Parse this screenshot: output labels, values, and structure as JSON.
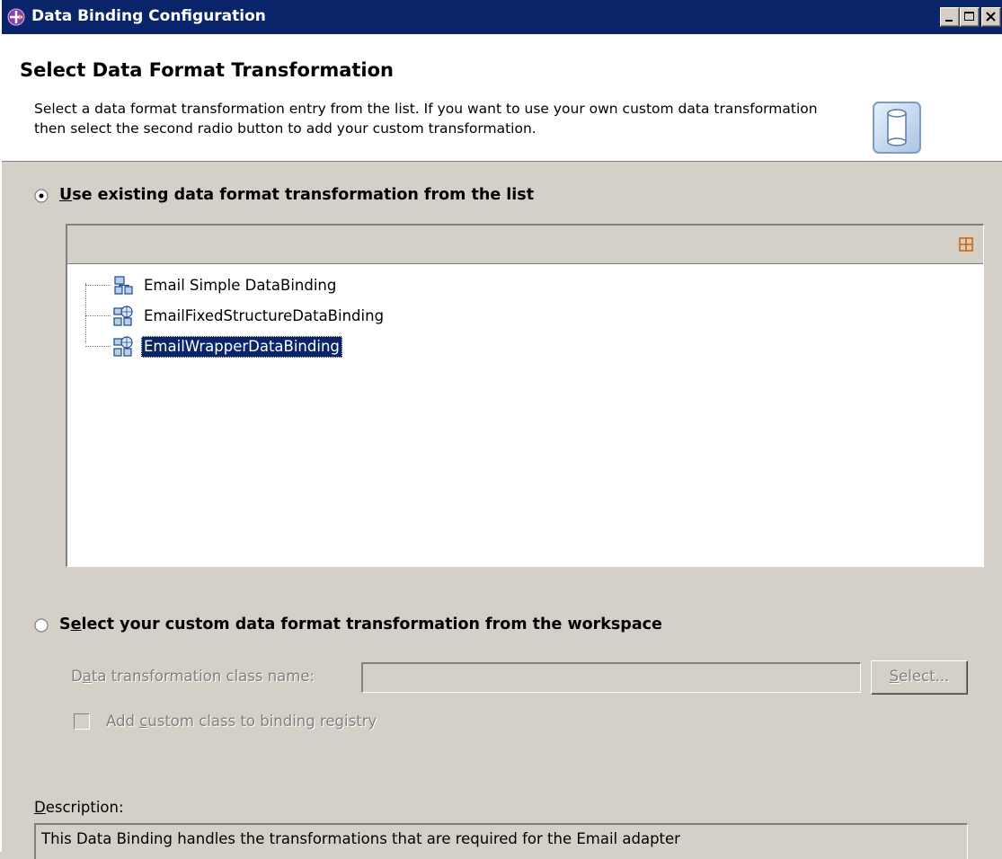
{
  "window": {
    "title": "Data Binding Configuration",
    "icon": "gear-plus-icon"
  },
  "header": {
    "title": "Select Data Format Transformation",
    "description": "Select a data format transformation entry from the list.  If you want to use your own custom data transformation then select the second radio button to add your custom transformation.",
    "icon": "database-cylinder-icon"
  },
  "option_existing": {
    "label_first": "U",
    "label_rest": "se existing data format transformation from the list",
    "selected": true
  },
  "tree": {
    "expand_icon": "expand-all-icon",
    "items": [
      {
        "label": "Email Simple DataBinding",
        "icon": "databinding-icon",
        "selected": false
      },
      {
        "label": "EmailFixedStructureDataBinding",
        "icon": "databinding-globe-icon",
        "selected": false
      },
      {
        "label": "EmailWrapperDataBinding",
        "icon": "databinding-globe-icon",
        "selected": true
      }
    ]
  },
  "option_custom": {
    "label_first": "S",
    "label_mid": "e",
    "label_rest": "lect your custom data format transformation from the workspace",
    "selected": false
  },
  "custom_form": {
    "class_label_a": "D",
    "class_label_b": "a",
    "class_label_c": "ta transformation class name:",
    "class_value": "",
    "select_button_a": "S",
    "select_button_b": "elect...",
    "checkbox_label_a": "Add ",
    "checkbox_label_b": "c",
    "checkbox_label_c": "ustom class to binding registry",
    "checkbox_checked": false
  },
  "description": {
    "label_a": "D",
    "label_b": "escription:",
    "text": "This Data Binding handles the transformations that are required for the Email adapter"
  },
  "colors": {
    "titlebar": "#0a246a",
    "dialog": "#d4d0c8",
    "selection": "#0a246a"
  }
}
